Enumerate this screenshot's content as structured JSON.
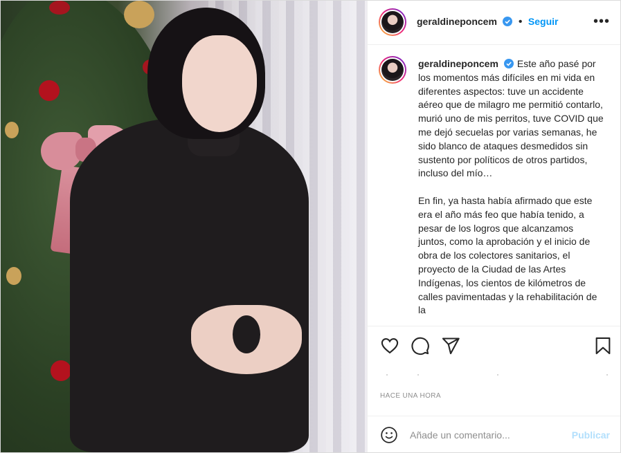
{
  "post": {
    "username": "geraldineponcem",
    "verified": true,
    "follow_label": "Seguir",
    "more_icon": "more-options-icon",
    "caption": "Este año pasé por los momentos más difíciles en mi vida en diferentes aspectos: tuve un accidente aéreo que de milagro me permitió contarlo, murió uno de mis perritos, tuve COVID que me dejó secuelas por varias semanas, he sido blanco de ataques desmedidos sin sustento por políticos de otros partidos, incluso del mío…\n\nEn fin, ya hasta había afirmado que este era el año más feo que había tenido, a pesar de los logros que alcanzamos juntos, como la aprobación y el inicio de obra de los colectores sanitarios, el proyecto de la Ciudad de las Artes Indígenas, los cientos de kilómetros de calles pavimentadas y la rehabilitación de la",
    "timestamp": "HACE UNA HORA"
  },
  "actions": {
    "like_icon": "heart-icon",
    "comment_icon": "comment-icon",
    "share_icon": "share-icon",
    "save_icon": "bookmark-icon"
  },
  "comment_box": {
    "emoji_icon": "emoji-icon",
    "placeholder": "Añade un comentario...",
    "publish_label": "Publicar"
  },
  "colors": {
    "link_blue": "#0095f6",
    "publish_disabled": "#b2dffc",
    "verified_blue": "#3897f0"
  }
}
